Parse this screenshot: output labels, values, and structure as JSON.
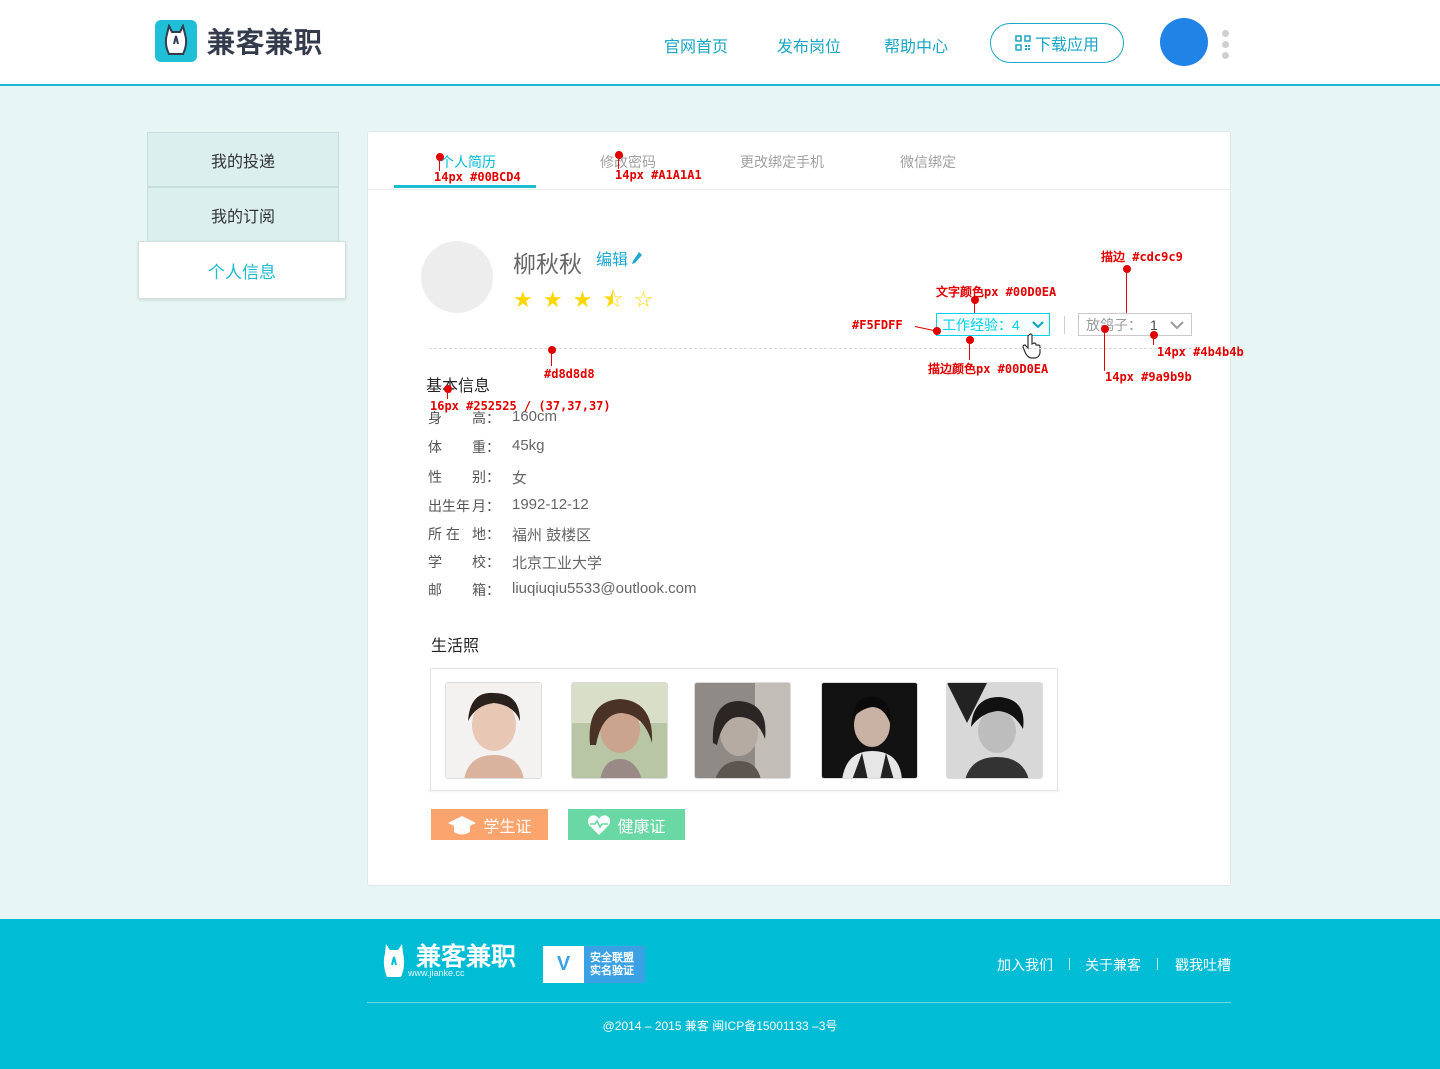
{
  "brand": {
    "name": "兼客兼职",
    "url": "www.jianke.cc"
  },
  "nav": {
    "home": "官网首页",
    "post": "发布岗位",
    "help": "帮助中心",
    "download": "下载应用"
  },
  "sidebar": {
    "items": [
      "我的投递",
      "我的订阅",
      "个人信息"
    ]
  },
  "tabs": [
    "个人简历",
    "修改密码",
    "更改绑定手机",
    "微信绑定"
  ],
  "profile": {
    "name": "柳秋秋",
    "edit_label": "编辑",
    "stars_full": "★ ★ ★",
    "stars_half": "⯪",
    "stars_empty": "☆"
  },
  "work_exp": {
    "label": "工作经验：",
    "value": "4"
  },
  "pigeon": {
    "label": "放鸽子：",
    "value": "1"
  },
  "basic_info": {
    "title": "基本信息",
    "rows": [
      {
        "k1": "身",
        "k2": "高：",
        "v": "160cm"
      },
      {
        "k1": "体",
        "k2": "重：",
        "v": "45kg"
      },
      {
        "k1": "性",
        "k2": "别：",
        "v": "女"
      },
      {
        "k1": "出生年",
        "k2": "月：",
        "v": "1992-12-12"
      },
      {
        "k1": "所 在",
        "k2": "地：",
        "v": "福州 鼓楼区"
      },
      {
        "k1": "学",
        "k2": "校：",
        "v": "北京工业大学"
      },
      {
        "k1": "邮",
        "k2": "箱：",
        "v": "liuqiuqiu5533@outlook.com"
      }
    ]
  },
  "life_photos": {
    "title": "生活照"
  },
  "badges": {
    "student": "学生证",
    "health": "健康证"
  },
  "annotations": {
    "a1": "14px #00BCD4",
    "a2": "14px #A1A1A1",
    "a3": "描边 #cdc9c9",
    "a4": "文字颜色px #00D0EA",
    "a5": "#F5FDFF",
    "a6": "#d8d8d8",
    "a7": "描边颜色px #00D0EA",
    "a8": "14px #4b4b4b",
    "a9": "14px #9a9b9b",
    "a10": "16px #252525 / (37,37,37)"
  },
  "footer": {
    "verify_line1": "安全联盟",
    "verify_line2": "实名验证",
    "links": [
      "加入我们",
      "关于兼客",
      "戳我吐槽"
    ],
    "copyright": "@2014 – 2015  兼客  闽ICP备15001133 –3号"
  },
  "colors": {
    "accent": "#00BCD4",
    "brand_blue": "#1F84E6",
    "student": "#FCA46E",
    "health": "#6AD8A4",
    "annotation": "#E00000"
  }
}
